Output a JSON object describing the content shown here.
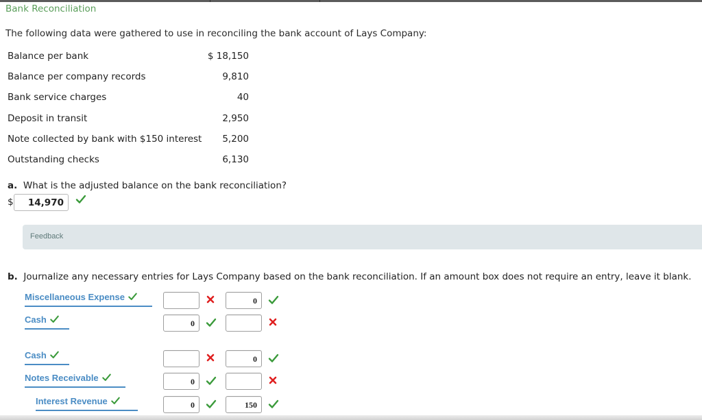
{
  "header": {
    "title": "Bank Reconciliation"
  },
  "intro": "The following data were gathered to use in reconciling the bank account of Lays Company:",
  "data_items": [
    {
      "label": "Balance per bank",
      "value": "$ 18,150"
    },
    {
      "label": "Balance per company records",
      "value": "9,810"
    },
    {
      "label": "Bank service charges",
      "value": "40"
    },
    {
      "label": "Deposit in transit",
      "value": "2,950"
    },
    {
      "label": "Note collected by bank with $150 interest",
      "value": "5,200"
    },
    {
      "label": "Outstanding checks",
      "value": "6,130"
    }
  ],
  "question_a": {
    "prefix": "a.",
    "text": "What is the adjusted balance on the bank reconciliation?",
    "currency": "$",
    "answer": "14,970",
    "status": "correct"
  },
  "feedback": {
    "label": "Feedback"
  },
  "question_b": {
    "prefix": "b.",
    "text": "Journalize any necessary entries for Lays Company based on the bank reconciliation. If an amount box does not require an entry, leave it blank."
  },
  "journal_entries": [
    {
      "lines": [
        {
          "account": "Miscellaneous Expense",
          "account_status": "correct",
          "debit": "",
          "debit_status": "incorrect",
          "credit": "0",
          "credit_status": "correct"
        },
        {
          "account": "Cash",
          "account_status": "correct",
          "debit": "0",
          "debit_status": "correct",
          "credit": "",
          "credit_status": "incorrect"
        }
      ]
    },
    {
      "lines": [
        {
          "account": "Cash",
          "account_status": "correct",
          "debit": "",
          "debit_status": "incorrect",
          "credit": "0",
          "credit_status": "correct"
        },
        {
          "account": "Notes Receivable",
          "account_status": "correct",
          "debit": "0",
          "debit_status": "correct",
          "credit": "",
          "credit_status": "incorrect"
        },
        {
          "account": "Interest Revenue",
          "account_status": "correct",
          "debit": "0",
          "debit_status": "correct",
          "credit": "150",
          "credit_status": "correct"
        }
      ]
    }
  ],
  "colors": {
    "title_green": "#5a9e5a",
    "account_blue": "#4a8cc4",
    "check_green": "#3a9a3a",
    "cross_red": "#e02020",
    "feedback_bg": "#dfe6e9"
  }
}
